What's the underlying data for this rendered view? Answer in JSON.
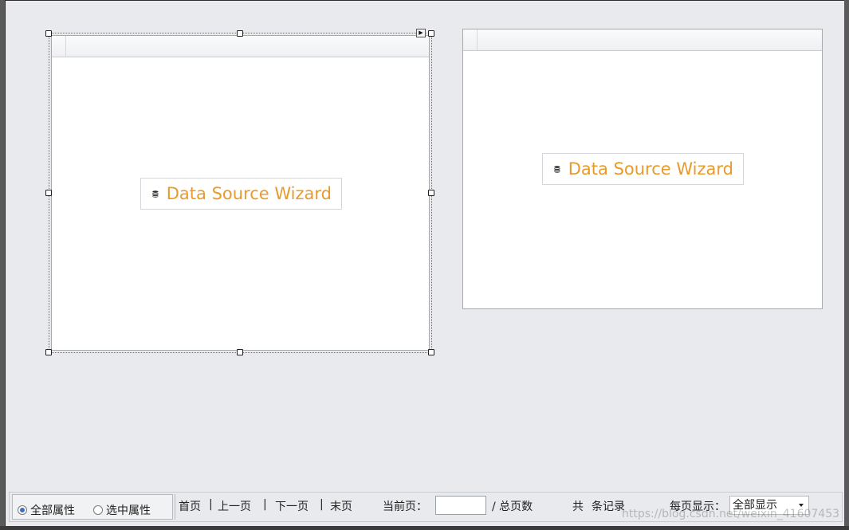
{
  "left_grid": {
    "wizard_label": "Data Source Wizard",
    "wizard_icon": "database-icon"
  },
  "right_grid": {
    "wizard_label": "Data Source Wizard",
    "wizard_icon": "database-icon"
  },
  "pager": {
    "radio_all": "全部属性",
    "radio_selected": "选中属性",
    "radio_all_checked": true,
    "first_page": "首页",
    "sep1": "|",
    "prev_page": "上一页",
    "sep2": "|",
    "next_page": "下一页",
    "sep3": "|",
    "last_page": "末页",
    "current_page_label": "当前页：",
    "current_page_value": "",
    "total_pages_label": "/ 总页数",
    "records_prefix": "共",
    "records_suffix": "条记录",
    "per_page_label": "每页显示：",
    "per_page_value": "全部显示"
  },
  "watermark": "https://blog.csdn.net/weixin_41607453",
  "colors": {
    "wizard_text": "#e89a2b",
    "designer_bg": "#e9eaee"
  }
}
